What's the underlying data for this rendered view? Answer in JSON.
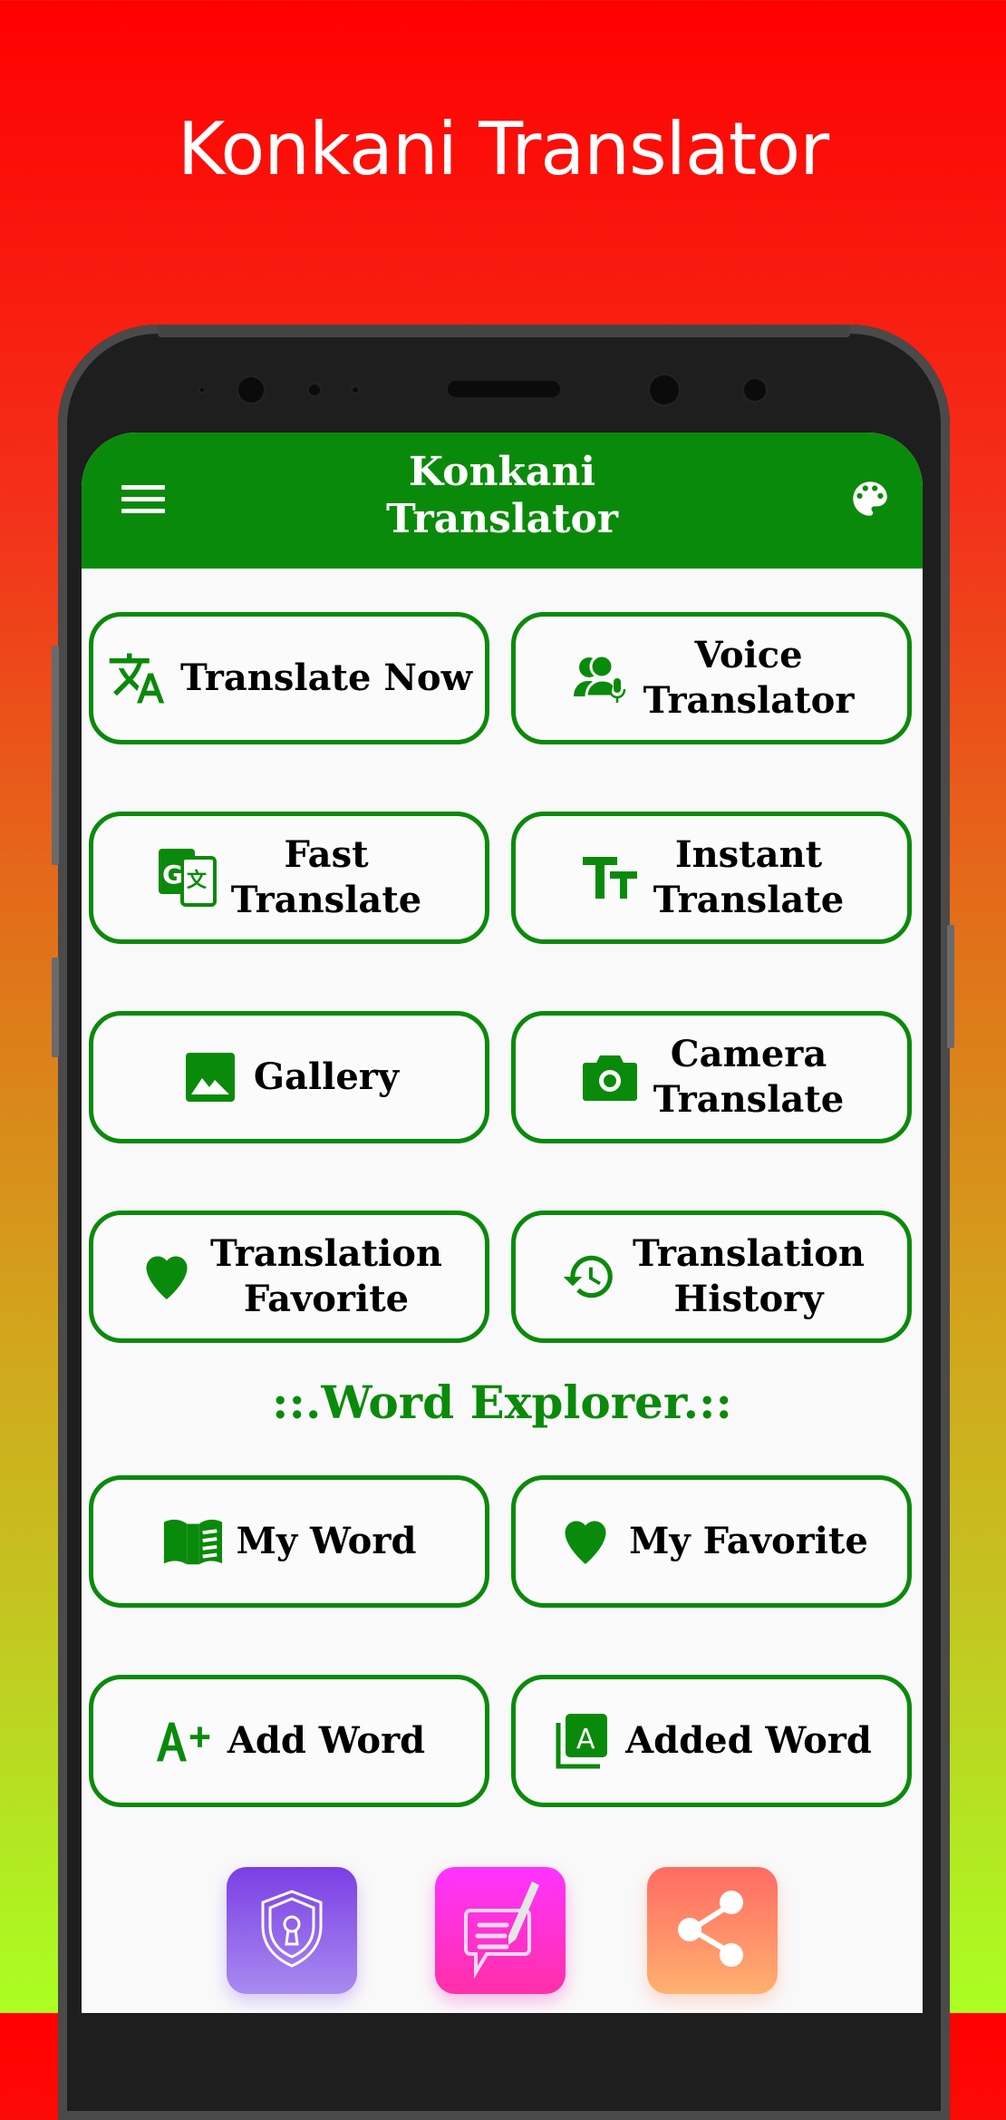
{
  "promo": {
    "title": "Konkani Translator"
  },
  "appbar": {
    "title_line1": "Konkani",
    "title_line2": "Translator",
    "menu_icon": "hamburger-menu-icon",
    "theme_icon": "palette-icon"
  },
  "colors": {
    "primary": "#0a8a0a",
    "background_top": "#ff0000",
    "background_bottom": "#aaff22",
    "button_border": "#0a8a0a",
    "privacy_gradient": [
      "#7b3fe4",
      "#a98af0"
    ],
    "feedback_gradient": [
      "#ff33ff",
      "#ff2fa8"
    ],
    "share_gradient": [
      "#ff6b63",
      "#ffb070"
    ]
  },
  "buttons": [
    {
      "id": "translate-now",
      "icon": "translate-icon",
      "line1": "Translate Now",
      "line2": ""
    },
    {
      "id": "voice-translator",
      "icon": "voice-people-mic-icon",
      "line1": "Voice",
      "line2": "Translator"
    },
    {
      "id": "fast-translate",
      "icon": "google-translate-icon",
      "line1": "Fast",
      "line2": "Translate"
    },
    {
      "id": "instant-translate",
      "icon": "text-size-icon",
      "line1": "Instant",
      "line2": "Translate"
    },
    {
      "id": "gallery",
      "icon": "image-icon",
      "line1": "Gallery",
      "line2": ""
    },
    {
      "id": "camera-translate",
      "icon": "camera-icon",
      "line1": "Camera",
      "line2": "Translate"
    },
    {
      "id": "translation-favorite",
      "icon": "heart-icon",
      "line1": "Translation",
      "line2": "Favorite"
    },
    {
      "id": "translation-history",
      "icon": "history-icon",
      "line1": "Translation",
      "line2": "History"
    },
    {
      "id": "my-word",
      "icon": "book-icon",
      "line1": "My Word",
      "line2": ""
    },
    {
      "id": "my-favorite",
      "icon": "heart-icon",
      "line1": "My Favorite",
      "line2": ""
    },
    {
      "id": "add-word",
      "icon": "font-size-increase-icon",
      "line1": "Add Word",
      "line2": ""
    },
    {
      "id": "added-word",
      "icon": "font-library-icon",
      "line1": "Added Word",
      "line2": ""
    }
  ],
  "section": {
    "word_explorer": "::.Word Explorer.::"
  },
  "bottom_actions": [
    {
      "id": "privacy",
      "icon": "shield-keyhole-icon"
    },
    {
      "id": "feedback",
      "icon": "chat-edit-icon"
    },
    {
      "id": "share",
      "icon": "share-icon"
    }
  ]
}
